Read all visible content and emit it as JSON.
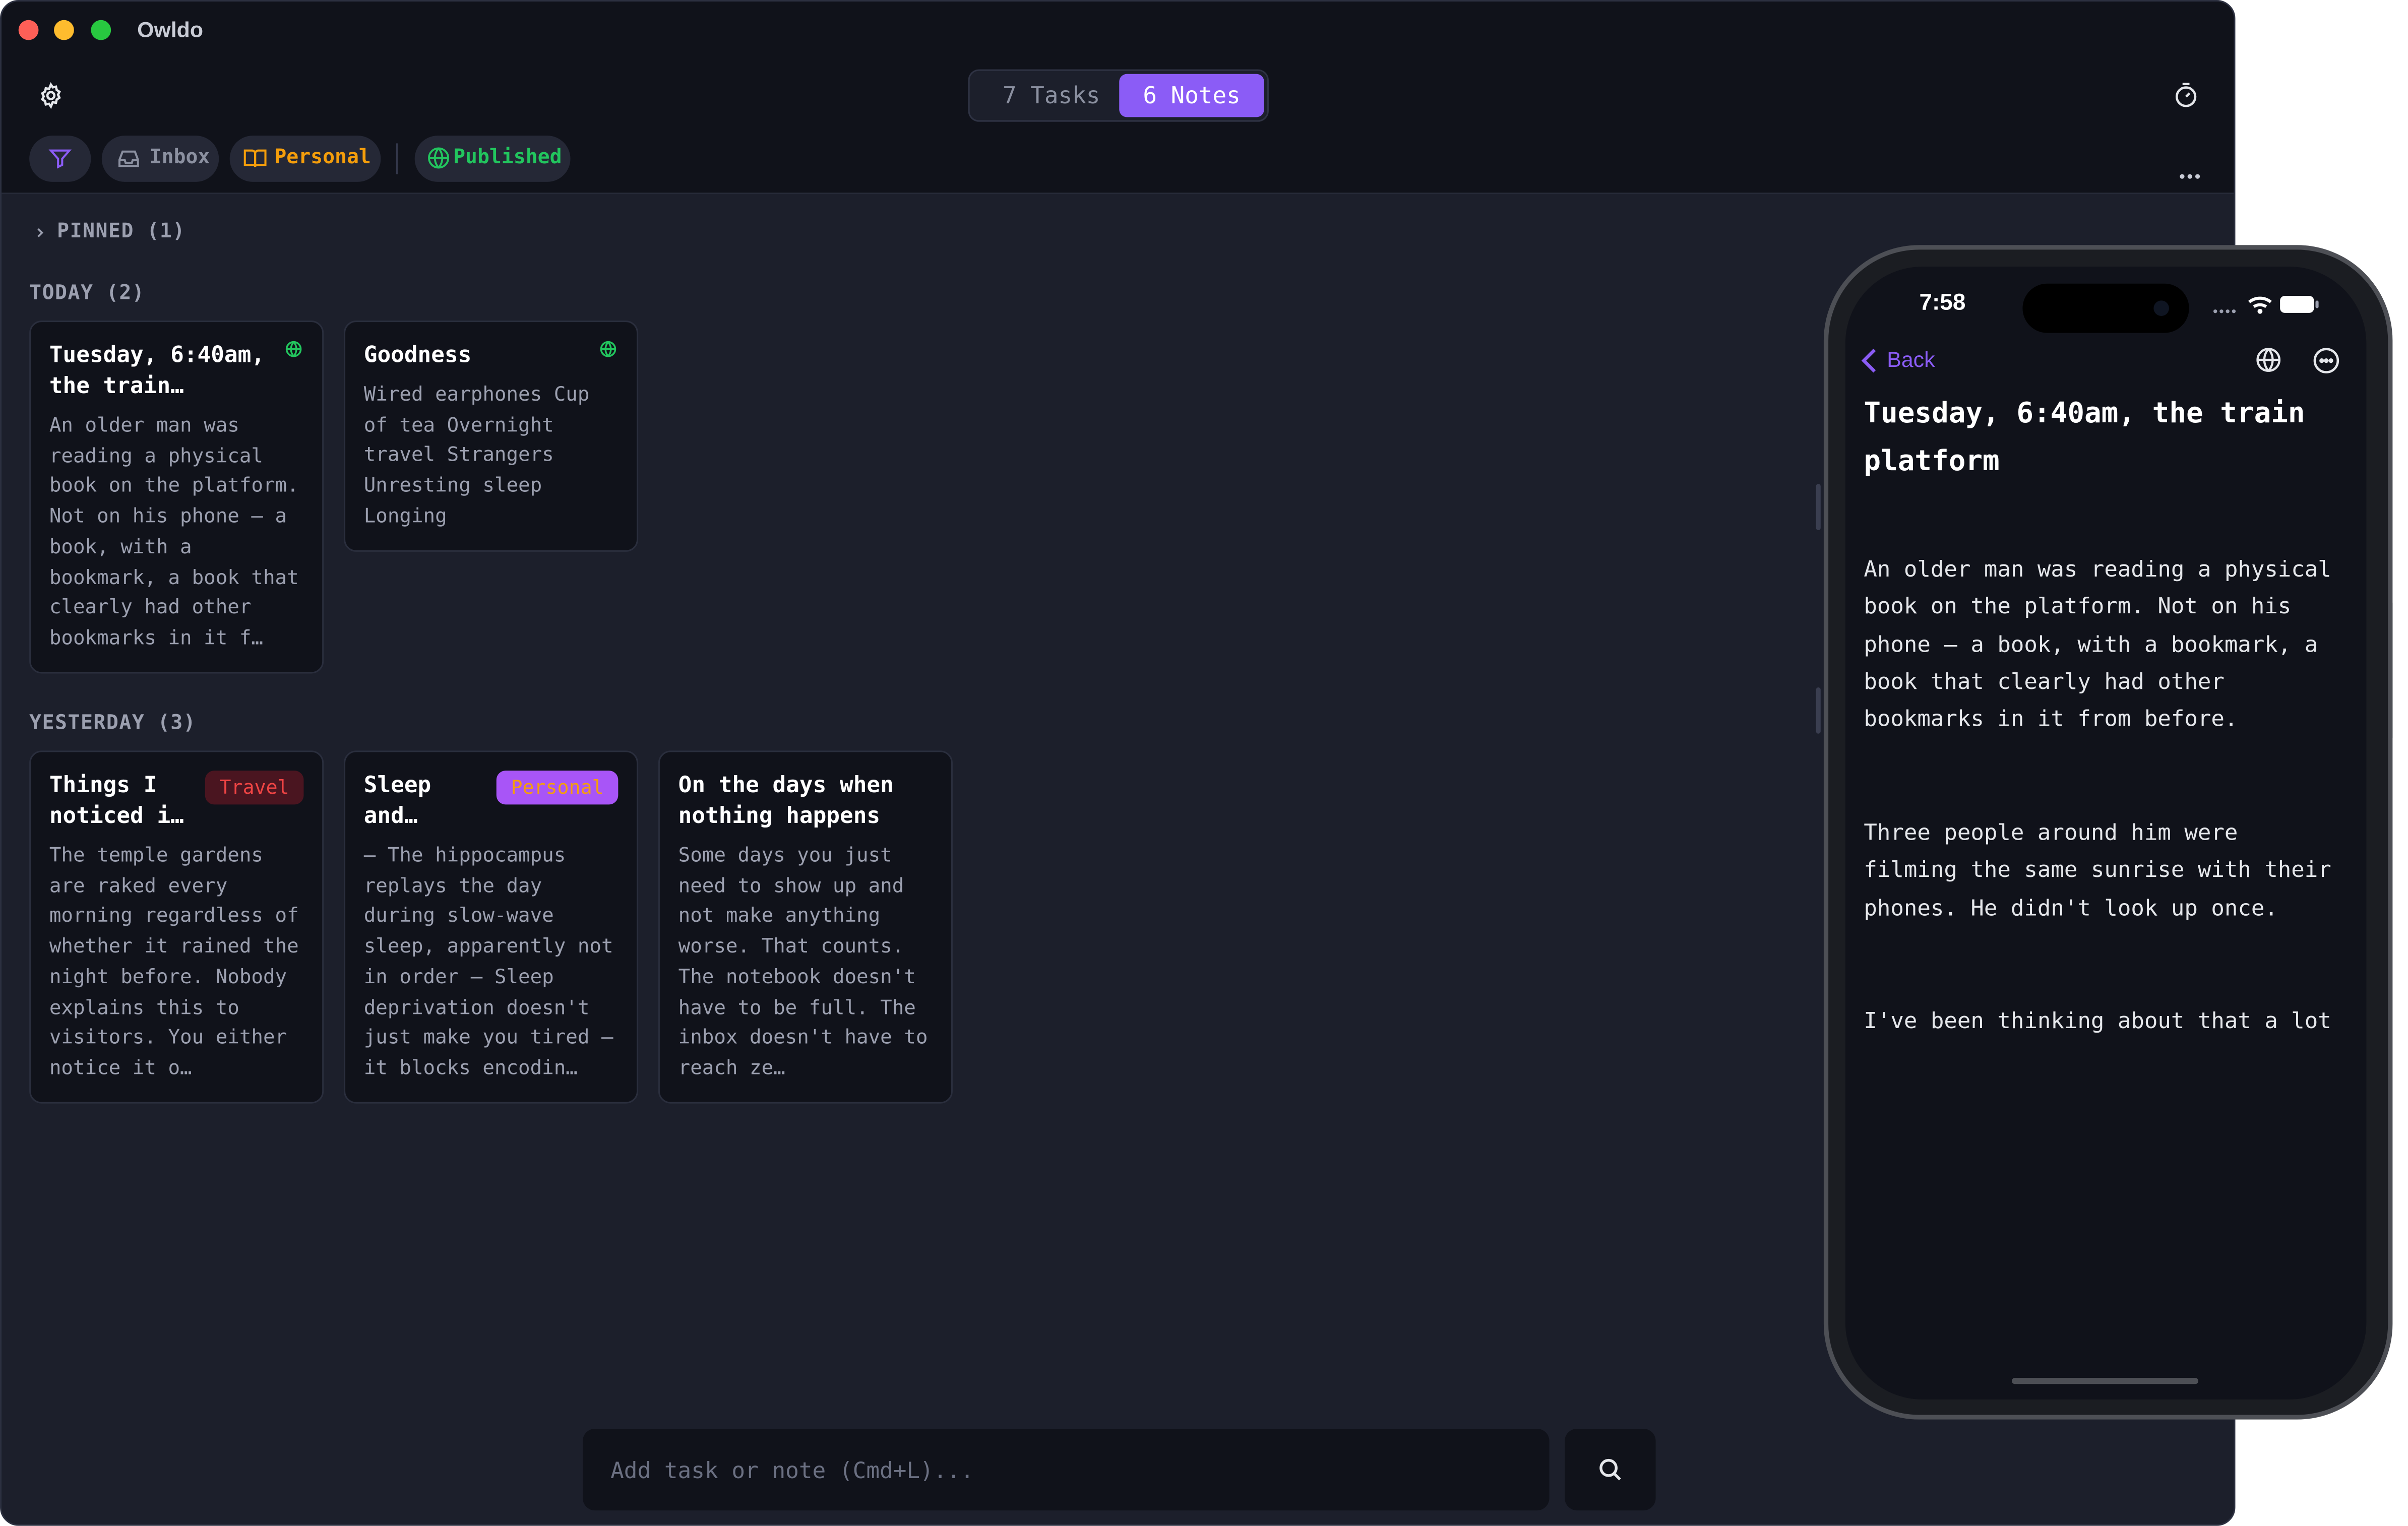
{
  "app": {
    "title": "Owldo"
  },
  "header": {
    "segments": [
      {
        "label": "7 Tasks",
        "active": false
      },
      {
        "label": "6 Notes",
        "active": true
      }
    ],
    "filter_chips": [
      {
        "label": "Inbox"
      },
      {
        "label": "Personal"
      },
      {
        "label": "Published"
      }
    ]
  },
  "colors": {
    "accent": "#8b5cf6",
    "personal": "#f59e0b",
    "published": "#22c55e",
    "travel": "#ef4444",
    "background": "#1c1f2b",
    "card": "#10121a"
  },
  "sections": {
    "pinned": "PINNED (1)",
    "today": "TODAY (2)",
    "yesterday": "YESTERDAY (3)"
  },
  "today_notes": [
    {
      "title_line1": "Tuesday, 6:40am,",
      "title_line2": "the train…",
      "body": "An older man was\nreading a physical\nbook on the platform.\nNot on his phone — a\nbook, with a\nbookmark, a book that\nclearly had other\nbookmarks in it f…",
      "published": true
    },
    {
      "title_line1": "Goodness",
      "body": "Wired earphones Cup\nof tea Overnight\ntravel Strangers\nUnresting sleep\nLonging",
      "published": true
    }
  ],
  "yesterday_notes": [
    {
      "title_line1": "Things I",
      "title_line2": "noticed i…",
      "tag": "Travel",
      "body": "The temple gardens\nare raked every\nmorning regardless of\nwhether it rained the\nnight before. Nobody\nexplains this to\nvisitors. You either\nnotice it o…"
    },
    {
      "title_line1": "Sleep",
      "title_line2": "and…",
      "tag": "Personal",
      "body": "— The hippocampus\nreplays the day\nduring slow-wave\nsleep, apparently not\nin order — Sleep\ndeprivation doesn't\njust make you tired —\nit blocks encodin…"
    },
    {
      "title_line1": "On the days when",
      "title_line2": "nothing happens",
      "body": "Some days you just\nneed to show up and\nnot make anything\nworse. That counts.\nThe notebook doesn't\nhave to be full. The\ninbox doesn't have to\nreach ze…"
    }
  ],
  "add_bar": {
    "placeholder": "Add task or note (Cmd+L)..."
  },
  "phone": {
    "time": "7:58",
    "back_label": "Back",
    "title_line1": "Tuesday, 6:40am, the train",
    "title_line2": "platform",
    "paragraphs": [
      "An older man was reading a physical\nbook on the platform. Not on his\nphone — a book, with a bookmark, a\nbook that clearly had other\nbookmarks in it from before.",
      "Three people around him were\nfilming the same sunrise with their\nphones. He didn't look up once.",
      "I've been thinking about that a lot"
    ]
  }
}
